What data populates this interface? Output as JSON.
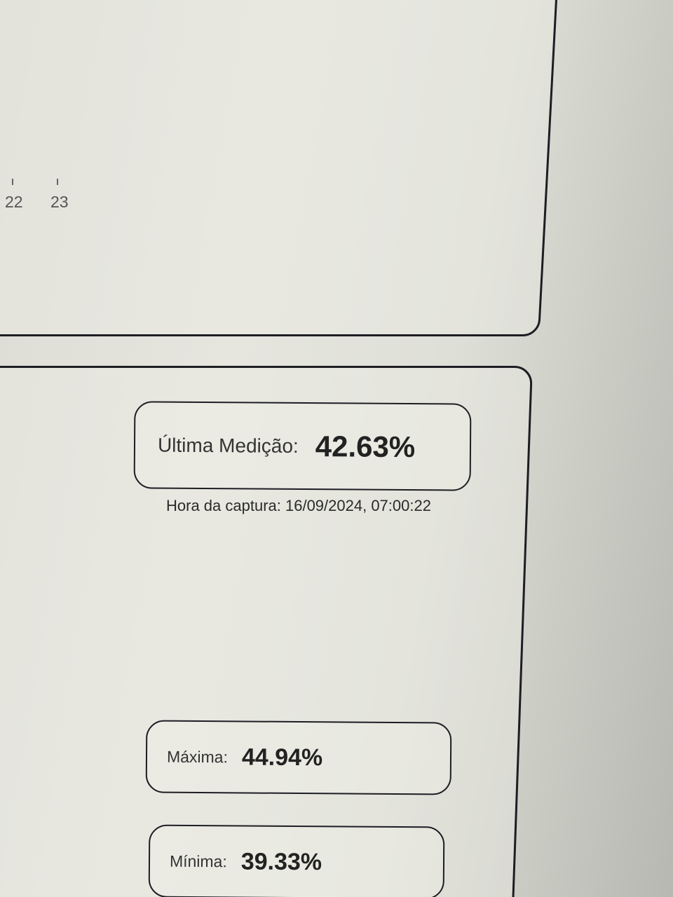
{
  "chart": {
    "x_tick_labels": [
      "22",
      "23"
    ]
  },
  "last_measurement": {
    "label": "Última Medição:",
    "value": "42.63%"
  },
  "capture": {
    "text": "Hora da captura: 16/09/2024, 07:00:22"
  },
  "maximum": {
    "label": "Máxima:",
    "value": "44.94%"
  },
  "minimum": {
    "label": "Mínima:",
    "value": "39.33%"
  }
}
